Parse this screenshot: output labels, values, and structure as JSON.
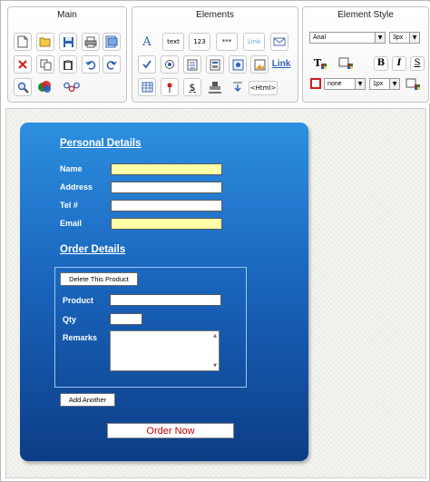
{
  "toolbar": {
    "main": {
      "title": "Main",
      "icons": [
        "new-document-icon",
        "open-folder-icon",
        "save-icon",
        "print-icon",
        "print-preview-icon",
        "delete-icon",
        "copy-icon",
        "paste-icon",
        "undo-icon",
        "redo-icon",
        "find-icon",
        "colors-icon",
        "group-icon"
      ]
    },
    "elements": {
      "title": "Elements",
      "label_tool": "A",
      "text_tool": "text",
      "number_tool": "123",
      "password_tool": "***",
      "link_tool": "Link",
      "link_tool_2": "Link",
      "html_tool": "<Html>",
      "icons": [
        "label-icon",
        "text-field-icon",
        "number-field-icon",
        "password-field-icon",
        "link-button-icon",
        "email-icon",
        "checkbox-icon",
        "radio-icon",
        "list-icon",
        "form-icon",
        "image-field-icon",
        "image-icon",
        "link-text-icon",
        "table-icon",
        "pin-icon",
        "dollar-icon",
        "stamp-icon",
        "dropdown-icon",
        "html-icon"
      ]
    },
    "style": {
      "title": "Element Style",
      "font_family": "Arial",
      "font_size": "3px",
      "border_style": "none",
      "border_width": "1px",
      "text_color_icon": "text-color-icon",
      "bg_color_icon": "background-color-icon",
      "bold": "B",
      "italic": "I",
      "underline": "S"
    }
  },
  "form": {
    "personal_title": "Personal Details",
    "fields": {
      "name_label": "Name",
      "address_label": "Address",
      "tel_label": "Tel #",
      "email_label": "Email"
    },
    "order_title": "Order Details",
    "delete_button": "Delete This Product",
    "product_label": "Product",
    "qty_label": "Qty",
    "remarks_label": "Remarks",
    "add_another": "Add Another",
    "order_now": "Order Now"
  },
  "colors": {
    "panel_top": "#2d8fe0",
    "panel_bottom": "#0c3d86",
    "highlight_field": "#ffffa8",
    "order_button_text": "#c00000"
  }
}
